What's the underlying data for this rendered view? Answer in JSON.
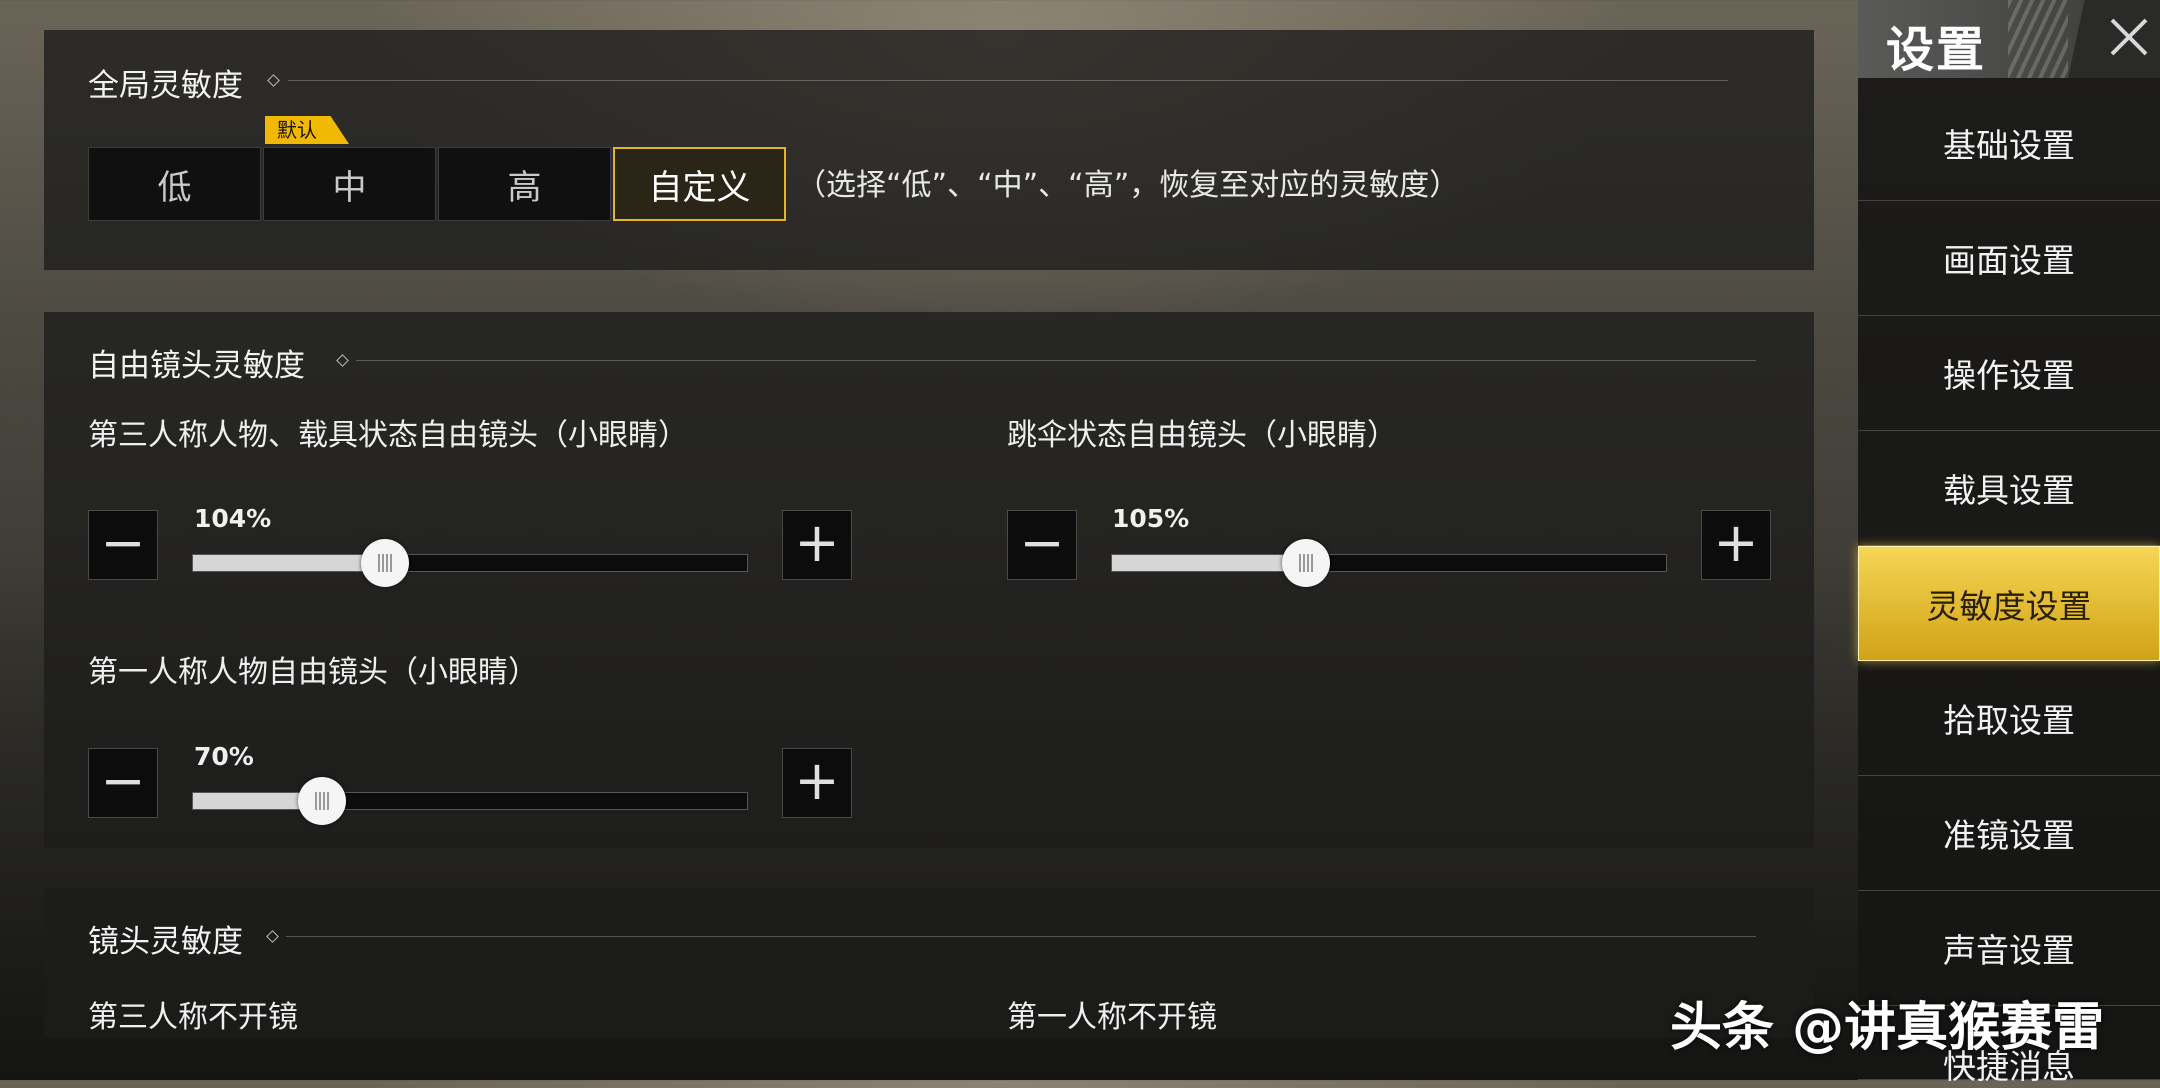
{
  "global_sensitivity": {
    "title": "全局灵敏度",
    "options": [
      "低",
      "中",
      "高",
      "自定义"
    ],
    "selected": "自定义",
    "default_badge": "默认",
    "note": "（选择“低”、“中”、“高”，恢复至对应的灵敏度）"
  },
  "free_camera": {
    "title": "自由镜头灵敏度",
    "sliders": [
      {
        "label": "第三人称人物、载具状态自由镜头（小眼睛）",
        "value_text": "104%",
        "value": 104
      },
      {
        "label": "跳伞状态自由镜头（小眼睛）",
        "value_text": "105%",
        "value": 105
      },
      {
        "label": "第一人称人物自由镜头（小眼睛）",
        "value_text": "70%",
        "value": 70
      }
    ],
    "minus_symbol": "−",
    "plus_symbol": "+"
  },
  "camera_sensitivity": {
    "title": "镜头灵敏度",
    "items": [
      "第三人称不开镜",
      "第一人称不开镜"
    ]
  },
  "sidebar": {
    "title": "设置",
    "items": [
      {
        "label": "基础设置"
      },
      {
        "label": "画面设置"
      },
      {
        "label": "操作设置"
      },
      {
        "label": "载具设置"
      },
      {
        "label": "灵敏度设置",
        "active": true
      },
      {
        "label": "拾取设置"
      },
      {
        "label": "准镜设置"
      },
      {
        "label": "声音设置"
      },
      {
        "label": "快捷消息"
      }
    ]
  },
  "watermark": "头条 @讲真猴赛雷",
  "colors": {
    "accent": "#e6b32c",
    "menu_active": "#f0c93a"
  }
}
